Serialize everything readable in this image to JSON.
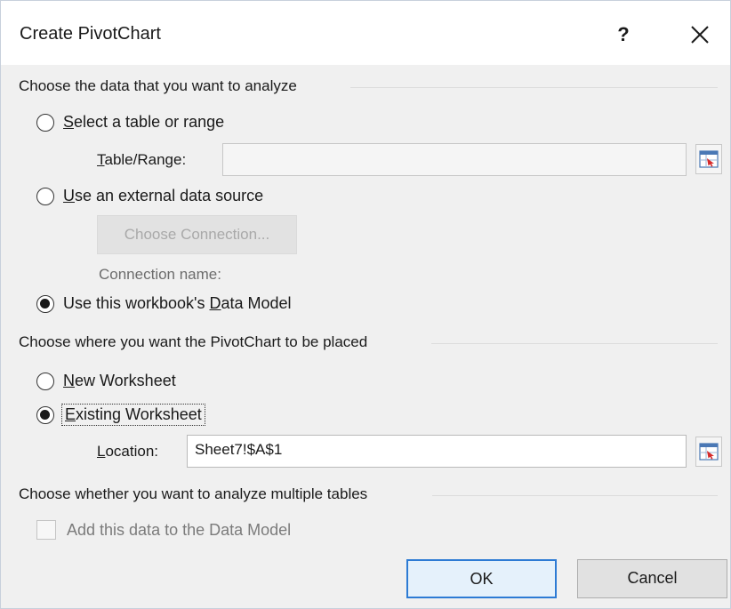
{
  "dialog": {
    "title": "Create PivotChart",
    "help_label": "?",
    "close_label": "close"
  },
  "section_data": {
    "label": "Choose the data that you want to analyze",
    "select_table": {
      "accel": "S",
      "rest": "elect a table or range",
      "checked": false
    },
    "table_range": {
      "accel": "T",
      "rest": "able/Range:",
      "value": ""
    },
    "external_source": {
      "accel": "U",
      "rest": "se an external data source",
      "checked": false
    },
    "choose_connection": "Choose Connection...",
    "connection_name": "Connection name:",
    "data_model": {
      "pre": "Use this workbook's ",
      "accel": "D",
      "rest": "ata Model",
      "checked": true
    }
  },
  "section_place": {
    "label": "Choose where you want the PivotChart to be placed",
    "new_worksheet": {
      "accel": "N",
      "rest": "ew Worksheet",
      "checked": false
    },
    "existing_worksheet": {
      "accel": "E",
      "rest": "xisting Worksheet",
      "checked": true
    },
    "location": {
      "accel": "L",
      "rest": "ocation:",
      "value": "Sheet7!$A$1"
    }
  },
  "section_multi": {
    "label": "Choose whether you want to analyze multiple tables",
    "add_to_model": {
      "label": "Add this data to the Data Model",
      "checked": false
    }
  },
  "buttons": {
    "ok": "OK",
    "cancel": "Cancel"
  },
  "colors": {
    "accent": "#2d7bd4",
    "background": "#f0f0f0"
  }
}
